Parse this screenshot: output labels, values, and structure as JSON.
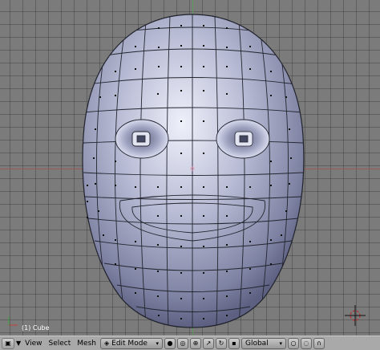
{
  "viewport": {
    "object_label": "(1) Cube"
  },
  "header": {
    "menus": [
      "View",
      "Select",
      "Mesh"
    ],
    "mode": "Edit Mode",
    "orientation": "Global"
  },
  "icons": {
    "editor_type": "cube-icon",
    "collapse": "triangle-down-icon",
    "mode": "edit-mode-icon",
    "shading": "circle-icon",
    "pivot": "pivot-icon",
    "manipulator": "manipulator-icon",
    "snap": "magnet-icon",
    "proportional": "circle-icon"
  },
  "colors": {
    "background": "#7b7b7b",
    "mesh_fill": "#a9acc6",
    "header": "#a9a9a9"
  }
}
